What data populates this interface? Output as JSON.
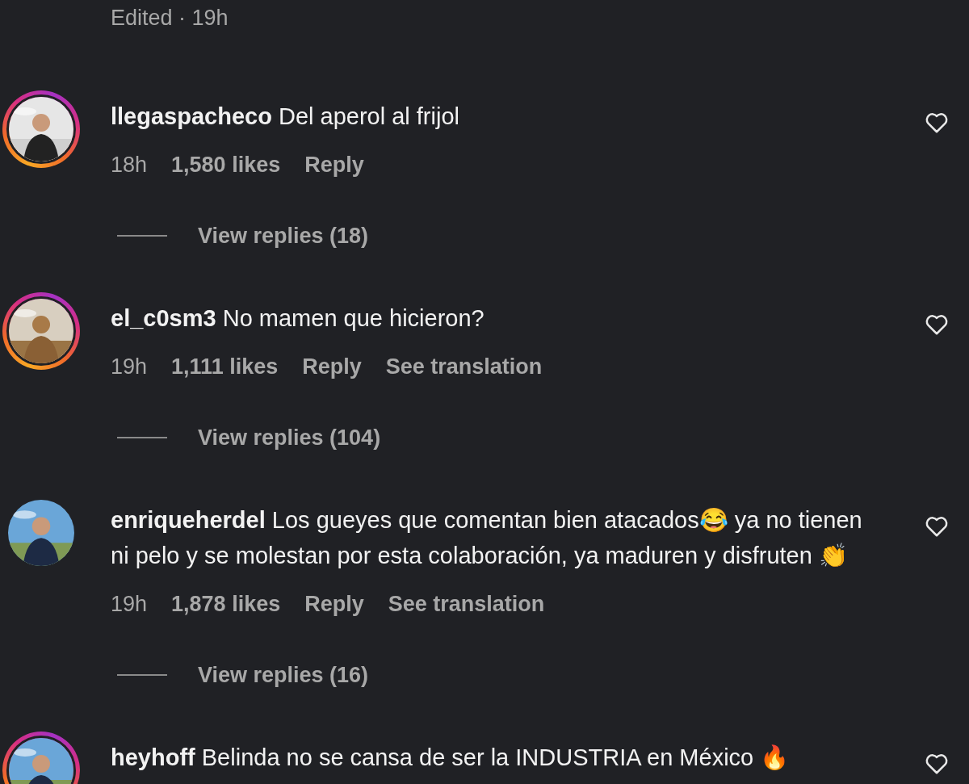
{
  "header_meta": "Edited · 19h",
  "comments": [
    {
      "username": "llegaspacheco",
      "text": "Del aperol al frijol",
      "story_ring": true,
      "time": "18h",
      "likes": "1,580 likes",
      "reply": "Reply",
      "view_replies": "View replies (18)"
    },
    {
      "username": "el_c0sm3",
      "text": "No mamen que hicieron?",
      "story_ring": true,
      "time": "19h",
      "likes": "1,111 likes",
      "reply": "Reply",
      "see_translation": "See translation",
      "view_replies": "View replies (104)"
    },
    {
      "username": "enriqueherdel",
      "text": "Los gueyes que comentan bien atacados😂  ya no tienen ni pelo y se molestan por esta colaboración, ya maduren y disfruten 👏",
      "story_ring": false,
      "time": "19h",
      "likes": "1,878 likes",
      "reply": "Reply",
      "see_translation": "See translation",
      "view_replies": "View replies (16)"
    },
    {
      "username": "heyhoff",
      "text": "Belinda no se cansa de ser la INDUSTRIA en México 🔥",
      "story_ring": true
    }
  ]
}
